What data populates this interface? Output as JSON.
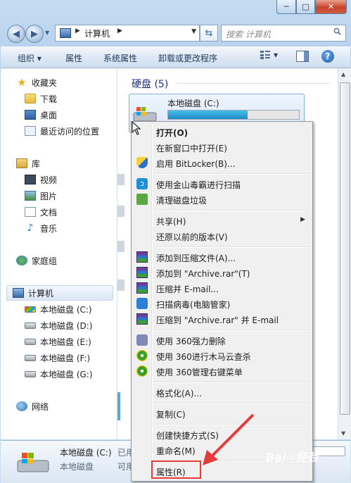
{
  "window": {
    "caption_min": "─",
    "caption_max": "□",
    "caption_close": "✕"
  },
  "address": {
    "crumb": "计算机",
    "search_placeholder": "搜索 计算机"
  },
  "toolbar": {
    "organize": "组织 ▾",
    "properties": "属性",
    "system_properties": "系统属性",
    "uninstall": "卸载或更改程序",
    "views_arrow": "▾"
  },
  "nav": {
    "favorites": "收藏夹",
    "downloads": "下载",
    "desktop": "桌面",
    "recent": "最近访问的位置",
    "libraries": "库",
    "videos": "视频",
    "pictures": "图片",
    "documents": "文档",
    "music": "音乐",
    "homegroup": "家庭组",
    "computer": "计算机",
    "drive_c": "本地磁盘 (C:)",
    "drive_d": "本地磁盘 (D:)",
    "drive_e": "本地磁盘 (E:)",
    "drive_f": "本地磁盘 (F:)",
    "drive_g": "本地磁盘 (G:)",
    "network": "网络"
  },
  "content": {
    "group_title": "硬盘 (5)",
    "drive_name": "本地磁盘 (C:)",
    "drive_usage_fraction": 0.61
  },
  "details": {
    "name": "本地磁盘 (C:)",
    "type": "本地磁盘",
    "used_label": "已用",
    "avail_label": "可用"
  },
  "menu": {
    "open": "打开(O)",
    "open_new_window": "在新窗口中打开(E)",
    "bitlocker": "启用 BitLocker(B)...",
    "kingsoft_scan": "使用金山毒霸进行扫描",
    "clean_disk": "清理磁盘垃圾",
    "share": "共享(H)",
    "restore": "还原以前的版本(V)",
    "add_archive": "添加到压缩文件(A)...",
    "add_archive_rar": "添加到 \"Archive.rar\"(T)",
    "compress_email": "压缩并 E-mail...",
    "scan_virus": "扫描病毒(电脑管家)",
    "compress_rar_email": "压缩到 \"Archive.rar\" 并 E-mail",
    "q360_delete": "使用 360强力删除",
    "q360_scan": "使用 360进行木马云查杀",
    "q360_manage": "使用 360管理右键菜单",
    "format": "格式化(A)...",
    "copy": "复制(C)",
    "shortcut": "创建快捷方式(S)",
    "rename": "重命名(M)",
    "properties": "属性(R)"
  },
  "colors": {
    "highlight_box": "#e63b3b",
    "group_title": "#1e3287",
    "usage_bar": "#1e8bc4"
  }
}
